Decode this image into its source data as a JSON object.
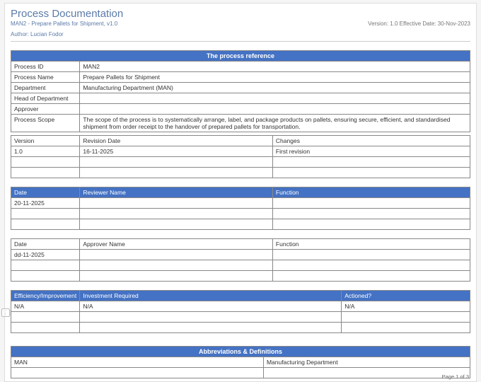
{
  "doc": {
    "title": "Process Documentation",
    "subtitle": "MAN2 - Prepare Pallets for Shipment, v1.0",
    "author_line": "Author: Lucian Fodor",
    "version_line": "Version: 1.0 Effective Date: 30-Nov-2023"
  },
  "ref": {
    "header": "The process reference",
    "rows": [
      {
        "label": "Process ID",
        "value": "MAN2"
      },
      {
        "label": "Process Name",
        "value": "Prepare Pallets for Shipment"
      },
      {
        "label": "Department",
        "value": "Manufacturing Department (MAN)"
      },
      {
        "label": "Head of Department",
        "value": ""
      },
      {
        "label": "Approver",
        "value": ""
      },
      {
        "label": "Process Scope",
        "value": "The scope of the process is to systematically arrange, label, and package products on pallets, ensuring secure, efficient, and standardised shipment from order receipt to the handover of prepared pallets for transportation."
      }
    ]
  },
  "versions": {
    "cols": [
      "Version",
      "Revision Date",
      "Changes"
    ],
    "rows": [
      [
        "1.0",
        "16-11-2025",
        "First revision"
      ],
      [
        "",
        "",
        ""
      ],
      [
        "",
        "",
        ""
      ]
    ]
  },
  "reviewers": {
    "cols": [
      "Date",
      "Reviewer Name",
      "Function"
    ],
    "rows": [
      [
        "20-11-2025",
        "",
        ""
      ],
      [
        "",
        "",
        ""
      ],
      [
        "",
        "",
        ""
      ]
    ]
  },
  "approvers": {
    "cols": [
      "Date",
      "Approver Name",
      "Function"
    ],
    "rows": [
      [
        "dd-11-2025",
        "",
        ""
      ],
      [
        "",
        "",
        ""
      ],
      [
        "",
        "",
        ""
      ]
    ]
  },
  "eff": {
    "cols": [
      "Efficiency/Improvement",
      "Investment Required",
      "Actioned?"
    ],
    "rows": [
      [
        "N/A",
        "N/A",
        "N/A"
      ],
      [
        "",
        "",
        ""
      ],
      [
        "",
        "",
        ""
      ]
    ]
  },
  "abbr": {
    "header": "Abbreviations & Definitions",
    "rows": [
      [
        "MAN",
        "Manufacturing Department"
      ],
      [
        "",
        ""
      ]
    ]
  },
  "footer": "Page 1 of 3",
  "anchor_icon": "⋮⋮"
}
